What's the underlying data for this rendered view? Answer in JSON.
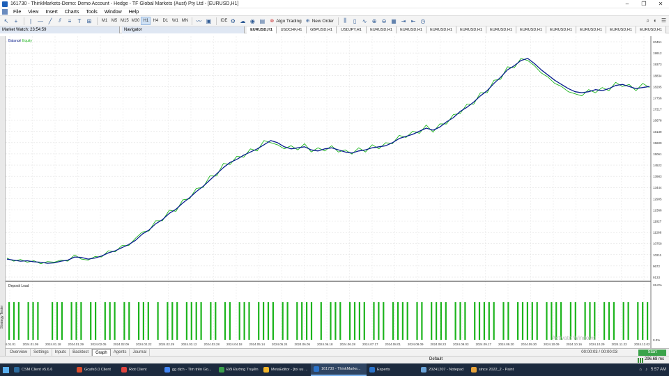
{
  "window": {
    "title": "161730 - ThinkMarkets-Demo: Demo Account - Hedge - TF Global Markets (Aust) Pty Ltd - [EURUSD,H1]",
    "controls": [
      "–",
      "❐",
      "✕"
    ]
  },
  "menu": [
    "File",
    "View",
    "Insert",
    "Charts",
    "Tools",
    "Window",
    "Help"
  ],
  "toolbar": {
    "timeframes": [
      "M1",
      "M5",
      "M15",
      "M30",
      "H1",
      "H4",
      "D1",
      "W1",
      "MN"
    ],
    "active_timeframe": "H1",
    "ide_label": "IDE",
    "algo_trading_label": "Algo Trading",
    "new_order_label": "New Order"
  },
  "panels": {
    "market_watch": "Market Watch: 23:54:59",
    "navigator": "Navigator"
  },
  "chart_tabs": [
    "EURUSD,H1",
    "USDCHF,H1",
    "GBPUSD,H1",
    "USDJPY,H1",
    "EURUSD,H1",
    "EURUSD,H1",
    "EURUSD,H1",
    "EURUSD,H1",
    "EURUSD,H1",
    "EURUSD,H1",
    "EURUSD,H1",
    "EURUSD,H1",
    "EURUSD,H1",
    "EURUSD,H1"
  ],
  "side_panel_label": "Strategy Tester",
  "chart_data": [
    {
      "type": "line",
      "legend": [
        "Balance",
        "Equity"
      ],
      "colors": {
        "balance": "#0a1f8f",
        "equity": "#1db41d"
      },
      "y_ticks": [
        "20451",
        "19912",
        "19373",
        "18834",
        "18295",
        "17756",
        "17217",
        "16678",
        "16139",
        "15600",
        "15061",
        "14522",
        "13983",
        "13444",
        "12905",
        "12366",
        "11827",
        "11288",
        "10750",
        "10211",
        "9672",
        "9133"
      ],
      "ylim": [
        9133,
        20451
      ],
      "x_ticks": [
        "2024.01.01",
        "2024.01.09",
        "2024.01.18",
        "2024.01.29",
        "2024.02.05",
        "2024.02.09",
        "2024.02.22",
        "2024.02.29",
        "2024.03.12",
        "2024.03.28",
        "2024.04.18",
        "2024.05.14",
        "2024.05.24",
        "2024.06.05",
        "2024.06.18",
        "2024.06.28",
        "2024.07.17",
        "2024.08.01",
        "2024.08.09",
        "2024.08.23",
        "2024.09.03",
        "2024.09.17",
        "2024.09.20",
        "2024.09.30",
        "2024.10.09",
        "2024.10.16",
        "2024.10.29",
        "2024.11.22",
        "2024.12.02"
      ],
      "balance": [
        10000,
        9950,
        9900,
        9920,
        9870,
        9850,
        9800,
        9820,
        9900,
        9950,
        10100,
        10080,
        10000,
        10050,
        10150,
        10300,
        10400,
        10550,
        10700,
        10900,
        11200,
        11400,
        11700,
        11900,
        12200,
        12400,
        12700,
        12950,
        13250,
        13500,
        13800,
        14100,
        14400,
        14650,
        14800,
        15000,
        15150,
        15300,
        15500,
        15700,
        15600,
        15400,
        15300,
        15350,
        15400,
        15250,
        15200,
        15300,
        15350,
        15250,
        15150,
        15100,
        15200,
        15250,
        15350,
        15400,
        15450,
        15600,
        15800,
        15900,
        16000,
        16150,
        16300,
        16200,
        16350,
        16600,
        16800,
        17100,
        17300,
        17550,
        17850,
        18100,
        18450,
        18750,
        19100,
        19300,
        19550,
        19650,
        19400,
        19100,
        18850,
        18600,
        18400,
        18200,
        18050,
        18000,
        18050,
        18150,
        18100,
        18200,
        18350,
        18400,
        18300,
        18200,
        18250,
        18300
      ],
      "equity": [
        10050,
        9900,
        9980,
        9850,
        9920,
        9780,
        9880,
        9850,
        9950,
        9900,
        10200,
        10000,
        9950,
        10120,
        10100,
        10400,
        10350,
        10650,
        10650,
        11000,
        11300,
        11350,
        11850,
        11850,
        12350,
        12300,
        12850,
        12900,
        13400,
        13450,
        14000,
        14000,
        14600,
        14550,
        14950,
        14900,
        15300,
        15200,
        15700,
        15600,
        15500,
        15300,
        15450,
        15250,
        15550,
        15150,
        15350,
        15200,
        15450,
        15150,
        15250,
        15050,
        15350,
        15150,
        15500,
        15300,
        15600,
        15550,
        15950,
        15850,
        16150,
        16050,
        16450,
        16100,
        16500,
        16500,
        16950,
        17000,
        17450,
        17450,
        18000,
        18000,
        18600,
        18650,
        19250,
        19200,
        19650,
        19550,
        19300,
        18950,
        18750,
        18450,
        18300,
        18050,
        17950,
        17850,
        18150,
        18000,
        18250,
        18100,
        18500,
        18300,
        18400,
        18100,
        18450,
        18250
      ]
    },
    {
      "type": "bar",
      "title": "Deposit Load",
      "y_ticks": [
        "26.0%",
        "0.0%"
      ],
      "ylim": [
        0,
        26
      ],
      "color": "#1db41d",
      "values": [
        19,
        19,
        19,
        0,
        19,
        19,
        19,
        0,
        0,
        19,
        19,
        19,
        0,
        19,
        19,
        19,
        0,
        19,
        19,
        0,
        19,
        19,
        19,
        0,
        19,
        19,
        0,
        19,
        19,
        19,
        0,
        19,
        0,
        19,
        19,
        19,
        0,
        19,
        19,
        19,
        19,
        0,
        19,
        19,
        0,
        19,
        19,
        0,
        19,
        19,
        19,
        0,
        19,
        19,
        19,
        19,
        0,
        19,
        19,
        0,
        19,
        19,
        19,
        19,
        0,
        19,
        0,
        19,
        19,
        19,
        0,
        19,
        19,
        19,
        19,
        0,
        19,
        19,
        19,
        0,
        19,
        19,
        19,
        19,
        0,
        19,
        19,
        0,
        19,
        19,
        19,
        19,
        0,
        19,
        19,
        19,
        0,
        19,
        19,
        19,
        19,
        19,
        0,
        19,
        19,
        0,
        19,
        19,
        19,
        19,
        19,
        0,
        19,
        19,
        19,
        19,
        0,
        19,
        19,
        0,
        19,
        19,
        19,
        0,
        19,
        19,
        19,
        0,
        19,
        19,
        0,
        19,
        19,
        19
      ]
    }
  ],
  "watermark": "Activate Windows",
  "tester_tabs": [
    "Overview",
    "Settings",
    "Inputs",
    "Backtest",
    "Graph",
    "Agents",
    "Journal"
  ],
  "active_tester_tab": "Graph",
  "tester": {
    "time": "00:00:03 / 00:00:03",
    "start_label": "Start"
  },
  "status": {
    "profile": "Default",
    "ping": "296.68 ms"
  },
  "taskbar": [
    {
      "label": "CSM Client v5.6.6",
      "color": "#2c6b9e"
    },
    {
      "label": "Gcafe3.0 Client",
      "color": "#d94b2b"
    },
    {
      "label": "Riot Client",
      "color": "#e0443e"
    },
    {
      "label": "gg dịch - Tìm trên Go...",
      "color": "#4285f4"
    },
    {
      "label": "Đổi Đường Truyền",
      "color": "#3a9e4a"
    },
    {
      "label": "MetaEditor - [toi uu ...",
      "color": "#f0b429"
    },
    {
      "label": "161730 - ThinkMarke...",
      "color": "#2a72c9"
    },
    {
      "label": "Experts",
      "color": "#2a72c9"
    },
    {
      "label": "20241207 - Notepad",
      "color": "#6aa3d8"
    },
    {
      "label": "since 2022_2 - Paint",
      "color": "#e8a33a"
    }
  ],
  "tray": {
    "time": "5:57 AM"
  }
}
